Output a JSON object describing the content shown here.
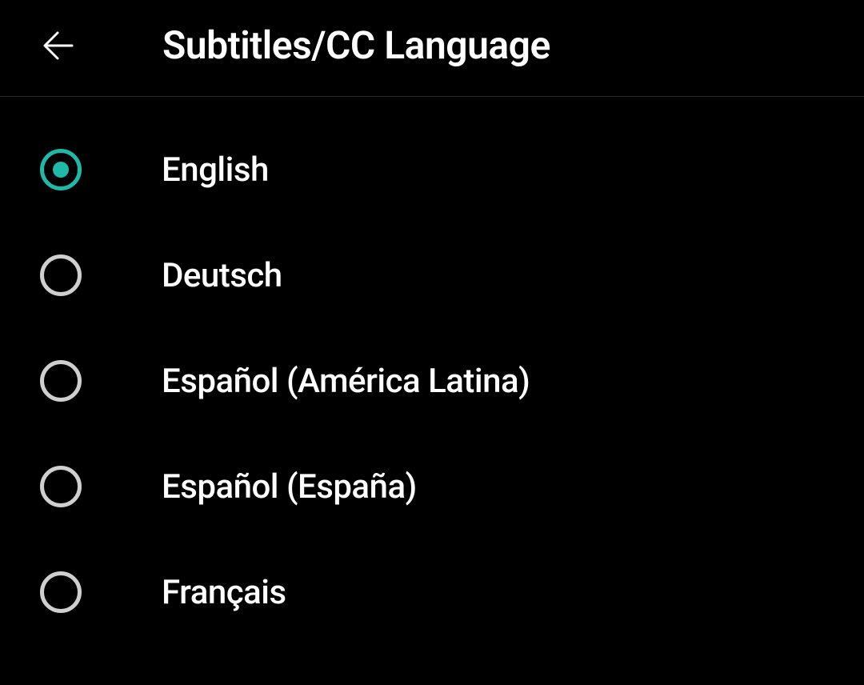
{
  "header": {
    "title": "Subtitles/CC Language"
  },
  "options": [
    {
      "label": "English",
      "selected": true
    },
    {
      "label": "Deutsch",
      "selected": false
    },
    {
      "label": "Español (América Latina)",
      "selected": false
    },
    {
      "label": "Español (España)",
      "selected": false
    },
    {
      "label": "Français",
      "selected": false
    }
  ],
  "colors": {
    "accent": "#1fb9a9",
    "background": "#000000",
    "text": "#ffffff",
    "radioBorder": "#cfcfcf"
  }
}
